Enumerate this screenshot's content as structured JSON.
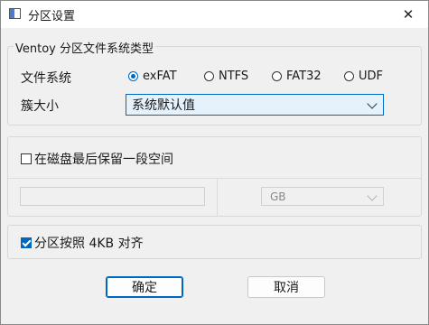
{
  "window": {
    "title": "分区设置",
    "close_glyph": "✕"
  },
  "partition_type": {
    "legend": "Ventoy 分区文件系统类型",
    "fs_label": "文件系统",
    "options": [
      {
        "label": "exFAT",
        "checked": true
      },
      {
        "label": "NTFS",
        "checked": false
      },
      {
        "label": "FAT32",
        "checked": false
      },
      {
        "label": "UDF",
        "checked": false
      }
    ],
    "cluster_label": "簇大小",
    "cluster_value": "系统默认值"
  },
  "reserve": {
    "checkbox_label": "在磁盘最后保留一段空间",
    "checked": false,
    "size_value": "",
    "unit_value": "GB"
  },
  "align": {
    "checkbox_label": "分区按照 4KB 对齐",
    "checked": true
  },
  "buttons": {
    "ok": "确定",
    "cancel": "取消"
  },
  "colors": {
    "accent": "#0067c0",
    "select_bg": "#e5f1fb",
    "window_bg": "#f0f0f0"
  }
}
